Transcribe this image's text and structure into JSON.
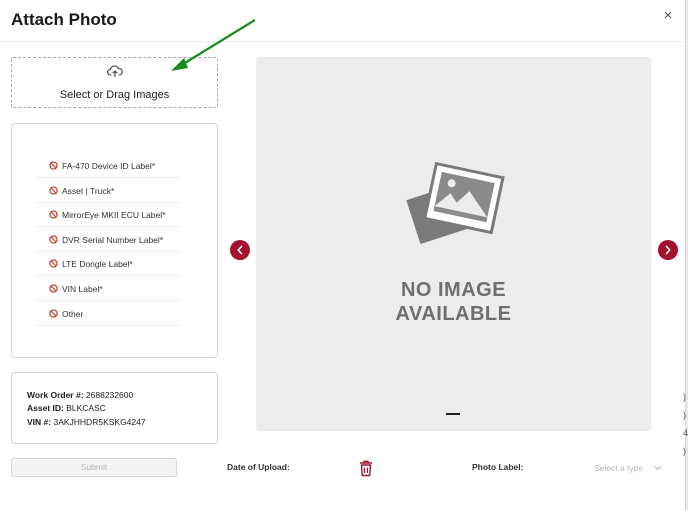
{
  "dialog": {
    "title": "Attach Photo",
    "close_glyph": "×"
  },
  "upload": {
    "label": "Select or Drag Images",
    "icon": "cloud-upload-icon"
  },
  "annotation": {
    "arrow_color": "#1a8a1a"
  },
  "photo_labels": [
    {
      "label": "FA-470 Device ID Label*",
      "icon": "ban-icon"
    },
    {
      "label": "Asset | Truck*",
      "icon": "ban-icon"
    },
    {
      "label": "MirrorEye MKII ECU Label*",
      "icon": "ban-icon"
    },
    {
      "label": "DVR Serial Number Label*",
      "icon": "ban-icon"
    },
    {
      "label": "LTE Dongle Label*",
      "icon": "ban-icon"
    },
    {
      "label": "VIN Label*",
      "icon": "ban-icon"
    },
    {
      "label": "Other",
      "icon": "ban-icon"
    }
  ],
  "work_info": {
    "work_order_label": "Work Order #:",
    "work_order_value": "2688232600",
    "asset_label": "Asset ID:",
    "asset_value": "BLKCASC",
    "vin_label": "VIN #:",
    "vin_value": "3AKJHHDR5KSKG4247"
  },
  "submit": {
    "label": "Submit",
    "disabled": true
  },
  "viewer": {
    "placeholder_line1": "NO IMAGE",
    "placeholder_line2": "AVAILABLE",
    "prev_icon": "chevron-left-icon",
    "next_icon": "chevron-right-icon"
  },
  "footer": {
    "date_label": "Date of Upload:",
    "photo_label_label": "Photo Label:",
    "photo_label_placeholder": "Select a type",
    "delete_icon": "trash-icon"
  },
  "background_edge": {
    "glyphs": [
      ")",
      ")",
      "4",
      ")"
    ]
  },
  "colors": {
    "accent": "#a3112e",
    "ban_icon": "#c0392b",
    "viewer_bg": "#ececec"
  }
}
